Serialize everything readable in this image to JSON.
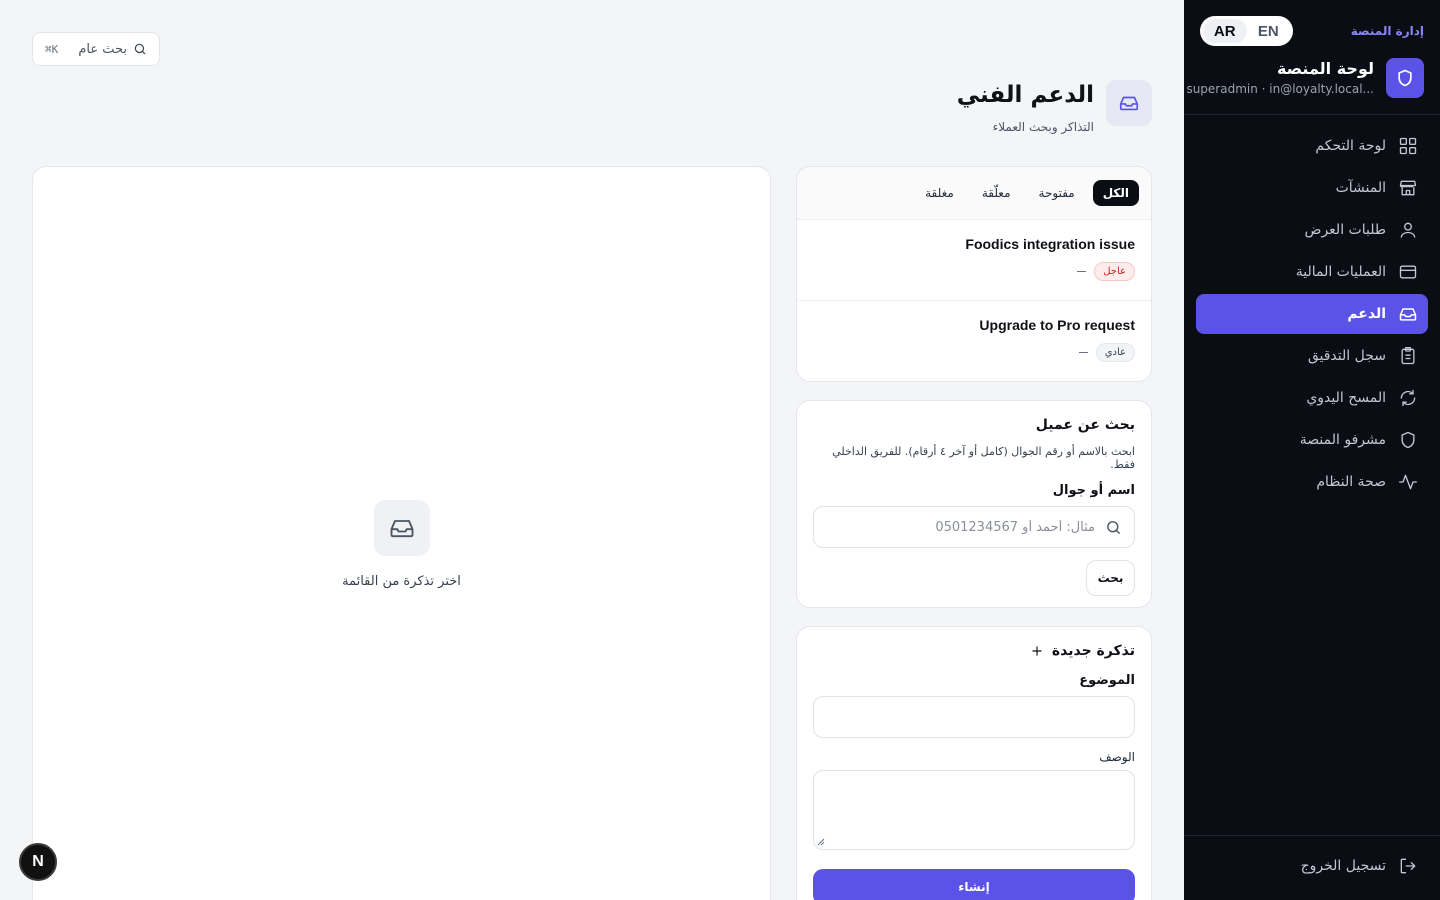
{
  "sidebar": {
    "admin_label": "إدارة المنصة",
    "lang": {
      "en": "EN",
      "ar": "AR",
      "active": "AR"
    },
    "brand": {
      "title": "لوحة المنصة",
      "subtitle": "superadmin · in@loyalty.local..."
    },
    "items": [
      {
        "label": "لوحة التحكم",
        "icon": "grid-icon"
      },
      {
        "label": "المنشآت",
        "icon": "store-icon"
      },
      {
        "label": "طلبات العرض",
        "icon": "user-icon"
      },
      {
        "label": "العمليات المالية",
        "icon": "credit-card-icon"
      },
      {
        "label": "الدعم",
        "icon": "inbox-icon",
        "active": true
      },
      {
        "label": "سجل التدقيق",
        "icon": "clipboard-icon"
      },
      {
        "label": "المسح اليدوي",
        "icon": "refresh-icon"
      },
      {
        "label": "مشرفو المنصة",
        "icon": "shield-icon"
      },
      {
        "label": "صحة النظام",
        "icon": "activity-icon"
      }
    ],
    "logout": "تسجيل الخروج"
  },
  "search": {
    "label": "بحث عام",
    "shortcut": "⌘K"
  },
  "page": {
    "title": "الدعم الفني",
    "subtitle": "التذاكر وبحث العملاء"
  },
  "tickets": {
    "tabs": [
      {
        "label": "الكل",
        "active": true
      },
      {
        "label": "مفتوحة"
      },
      {
        "label": "معلّقة"
      },
      {
        "label": "مغلقة"
      }
    ],
    "items": [
      {
        "title": "Foodics integration issue",
        "priority": "عاجل",
        "priority_kind": "urgent",
        "meta": "—"
      },
      {
        "title": "Upgrade to Pro request",
        "priority": "عادي",
        "priority_kind": "normal",
        "meta": "—"
      }
    ]
  },
  "customer_search": {
    "title": "بحث عن عميل",
    "description": "ابحث بالاسم أو رقم الجوال (كامل أو آخر ٤ أرقام). للفريق الداخلي فقط.",
    "label": "اسم أو جوال",
    "placeholder": "مثال: أحمد أو 0501234567",
    "button": "بحث"
  },
  "new_ticket": {
    "title": "تذكرة جديدة",
    "subject_label": "الموضوع",
    "description_label": "الوصف",
    "submit": "إنشاء"
  },
  "detail": {
    "empty_text": "اختر تذكرة من القائمة"
  },
  "colors": {
    "accent": "#5b52e8",
    "sidebar_bg": "#0b0d14",
    "page_bg": "#f4f5f7"
  },
  "dev_badge": "N"
}
